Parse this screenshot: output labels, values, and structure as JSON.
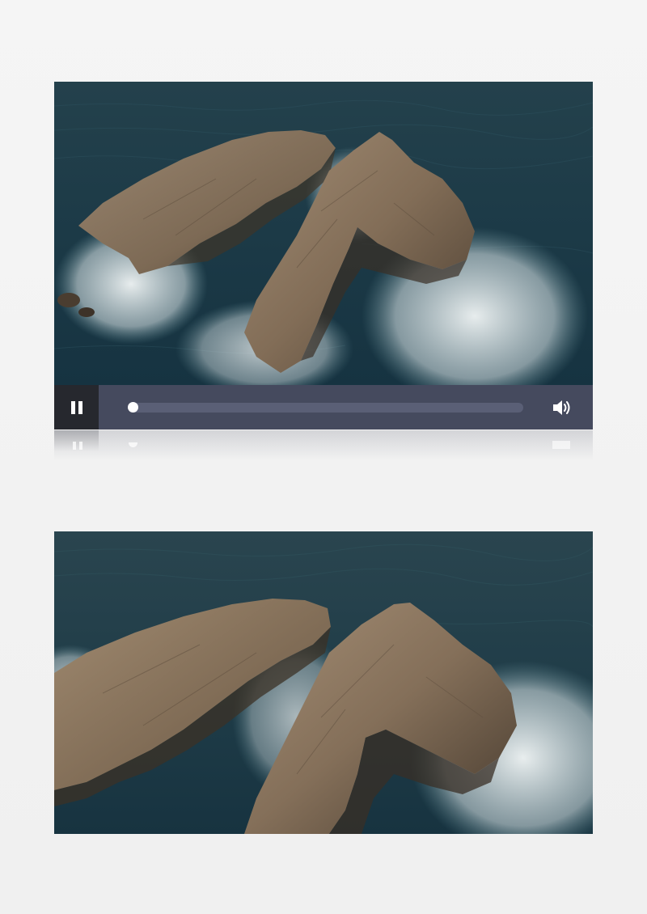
{
  "player": {
    "state": "playing",
    "progress": 0,
    "controls": {
      "toggle_icon": "pause-icon",
      "volume_icon": "volume-icon"
    }
  },
  "colors": {
    "control_bar": "#454a5e",
    "play_button": "#26282e",
    "track": "#5a5f76",
    "knob": "#ffffff",
    "sea": "#1f3a45",
    "rock": "#8a7660",
    "foam": "#e8eef0"
  }
}
